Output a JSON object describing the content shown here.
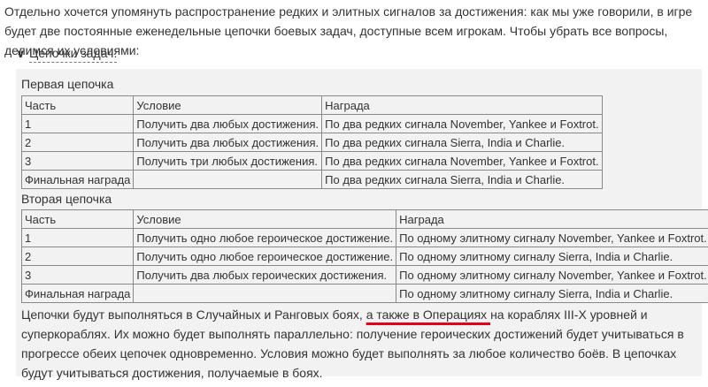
{
  "intro": "Отдельно хочется упомянуть распространение редких и элитных сигналов за достижения: как мы уже говорили, в игре будет две постоянные еженедельные цепочки боевых задач, доступные всем игрокам. Чтобы убрать все вопросы, делимся их условиями:",
  "spoiler": {
    "chevron": "∨",
    "title": "Цепочки задач:"
  },
  "chain1": {
    "title": "Первая цепочка",
    "headers": [
      "Часть",
      "Условие",
      "Награда"
    ],
    "rows": [
      [
        "1",
        "Получить два любых достижения.",
        "По два редких сигнала November, Yankee и Foxtrot."
      ],
      [
        "2",
        "Получить два любых достижения.",
        "По два редких сигнала Sierra, India и Charlie."
      ],
      [
        "3",
        "Получить три любых достижения.",
        "По два редких сигнала November, Yankee и Foxtrot."
      ],
      [
        "Финальная награда",
        "",
        "По два редких сигнала Sierra, India и Charlie."
      ]
    ]
  },
  "chain2": {
    "title": "Вторая цепочка",
    "headers": [
      "Часть",
      "Условие",
      "Награда"
    ],
    "rows": [
      [
        "1",
        "Получить одно любое героическое достижение.",
        "По одному элитному сигналу November, Yankee и Foxtrot."
      ],
      [
        "2",
        "Получить одно любое героическое достижение.",
        "По одному элитному сигналу Sierra, India и Charlie."
      ],
      [
        "3",
        "Получить два любых героических достижения.",
        "По одному элитному сигналу November, Yankee и Foxtrot."
      ],
      [
        "Финальная награда",
        "",
        "По одному элитному сигналу Sierra, India и Charlie."
      ]
    ]
  },
  "outro": {
    "before": "Цепочки будут выполняться в Случайных и Ранговых боях, ",
    "highlight": "а также в Операциях ",
    "after": "на кораблях III-X уровней и суперкораблях. Их можно будет выполнять параллельно: получение героических достижений будет учитываться в прогрессе обеих цепочек одновременно. Условия можно будет выполнять за любое количество боёв. В цепочках будут учитываться достижения, получаемые в боях.",
    "highlight_color": "#e0001a"
  }
}
